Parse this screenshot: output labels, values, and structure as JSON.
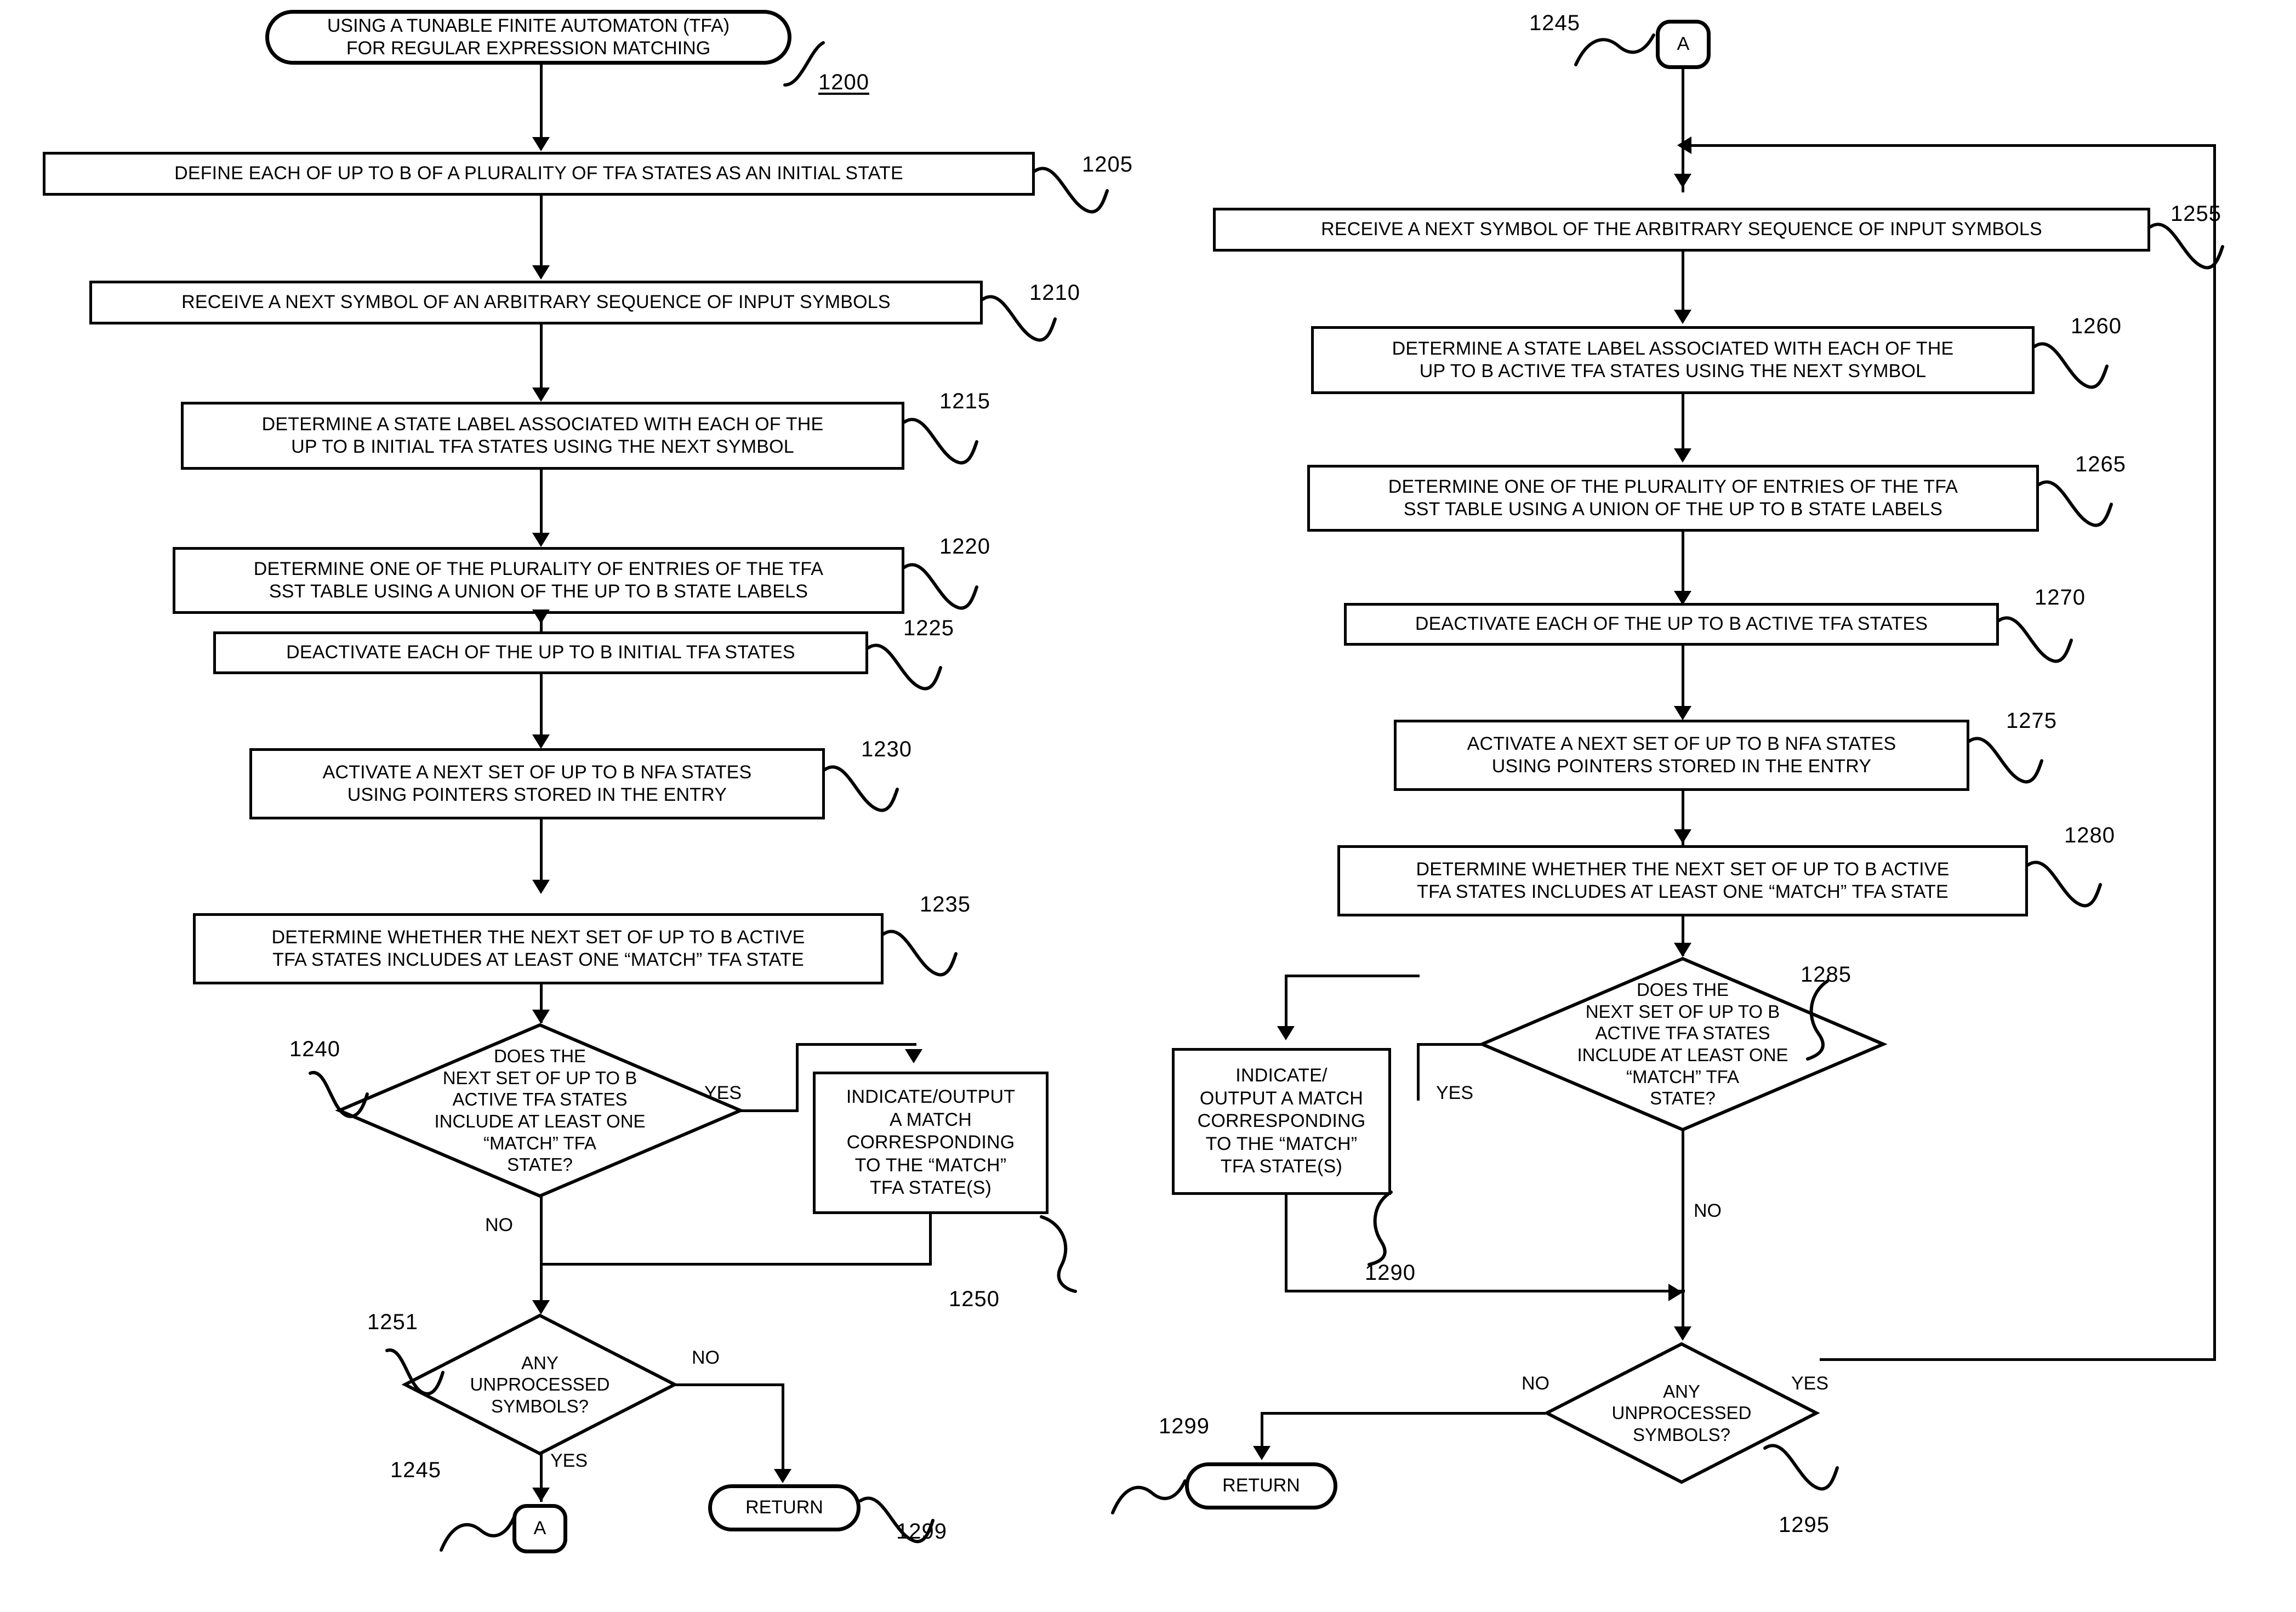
{
  "figure": {
    "title_node": {
      "label": "USING A TUNABLE FINITE AUTOMATON (TFA)\nFOR REGULAR EXPRESSION MATCHING",
      "line1": "USING A TUNABLE FINITE AUTOMATON (TFA)",
      "line2": "FOR REGULAR EXPRESSION MATCHING",
      "ref": "1200"
    }
  },
  "left_column": {
    "step_1205": {
      "text": "DEFINE EACH OF UP TO B OF A PLURALITY OF TFA STATES AS AN INITIAL STATE",
      "ref": "1205"
    },
    "step_1210": {
      "text": "RECEIVE A NEXT SYMBOL OF AN ARBITRARY SEQUENCE OF INPUT SYMBOLS",
      "ref": "1210"
    },
    "step_1215": {
      "line1": "DETERMINE A STATE LABEL ASSOCIATED WITH EACH OF THE",
      "line2": "UP TO B INITIAL TFA STATES USING THE NEXT SYMBOL",
      "ref": "1215"
    },
    "step_1220": {
      "line1": "DETERMINE ONE OF THE PLURALITY OF ENTRIES OF THE TFA",
      "line2": "SST TABLE USING A UNION OF THE UP TO B STATE LABELS",
      "ref": "1220"
    },
    "step_1225": {
      "text": "DEACTIVATE EACH OF THE UP TO B INITIAL TFA STATES",
      "ref": "1225"
    },
    "step_1230": {
      "line1": "ACTIVATE A NEXT SET OF UP TO B NFA STATES",
      "line2": "USING POINTERS STORED IN THE ENTRY",
      "ref": "1230"
    },
    "step_1235": {
      "line1": "DETERMINE WHETHER THE NEXT SET OF UP TO B ACTIVE",
      "line2": "TFA STATES INCLUDES AT LEAST ONE “MATCH” TFA STATE",
      "ref": "1235"
    },
    "decision_1240": {
      "line1": "DOES THE",
      "line2": "NEXT SET OF UP TO B",
      "line3": "ACTIVE TFA STATES",
      "line4": "INCLUDE AT LEAST ONE",
      "line5": "“MATCH” TFA",
      "line6": "STATE?",
      "ref": "1240",
      "yes_label": "YES",
      "no_label": "NO"
    },
    "step_1250": {
      "line1": "INDICATE/OUTPUT",
      "line2": "A MATCH",
      "line3": "CORRESPONDING",
      "line4": "TO THE “MATCH”",
      "line5": "TFA STATE(S)",
      "ref": "1250"
    },
    "decision_1251": {
      "line1": "ANY",
      "line2": "UNPROCESSED",
      "line3": "SYMBOLS?",
      "ref": "1251",
      "yes_label": "YES",
      "no_label": "NO"
    },
    "connector_1245": {
      "label": "A",
      "ref": "1245"
    },
    "return_1299": {
      "label": "RETURN",
      "ref": "1299"
    }
  },
  "right_column": {
    "connector_1245": {
      "label": "A",
      "ref": "1245"
    },
    "step_1255": {
      "text": "RECEIVE A NEXT SYMBOL OF THE ARBITRARY SEQUENCE OF INPUT SYMBOLS",
      "ref": "1255"
    },
    "step_1260": {
      "line1": "DETERMINE A STATE LABEL ASSOCIATED WITH EACH OF THE",
      "line2": "UP TO B ACTIVE TFA STATES USING THE NEXT SYMBOL",
      "ref": "1260"
    },
    "step_1265": {
      "line1": "DETERMINE ONE OF THE PLURALITY OF ENTRIES OF THE TFA",
      "line2": "SST TABLE USING A UNION OF THE UP TO B STATE LABELS",
      "ref": "1265"
    },
    "step_1270": {
      "text": "DEACTIVATE EACH OF THE UP TO B ACTIVE TFA STATES",
      "ref": "1270"
    },
    "step_1275": {
      "line1": "ACTIVATE A NEXT SET OF UP TO B NFA STATES",
      "line2": "USING POINTERS STORED IN THE ENTRY",
      "ref": "1275"
    },
    "step_1280": {
      "line1": "DETERMINE WHETHER THE NEXT SET OF UP TO B ACTIVE",
      "line2": "TFA STATES INCLUDES AT LEAST ONE “MATCH” TFA STATE",
      "ref": "1280"
    },
    "decision_1285": {
      "line1": "DOES THE",
      "line2": "NEXT SET OF UP TO B",
      "line3": "ACTIVE TFA STATES",
      "line4": "INCLUDE AT LEAST ONE",
      "line5": "“MATCH” TFA",
      "line6": "STATE?",
      "ref": "1285",
      "yes_label": "YES",
      "no_label": "NO"
    },
    "step_1290": {
      "line1": "INDICATE/",
      "line2": "OUTPUT A MATCH",
      "line3": "CORRESPONDING",
      "line4": "TO THE “MATCH”",
      "line5": "TFA STATE(S)",
      "ref": "1290"
    },
    "decision_1295": {
      "line1": "ANY",
      "line2": "UNPROCESSED",
      "line3": "SYMBOLS?",
      "ref": "1295",
      "yes_label": "YES",
      "no_label": "NO"
    },
    "return_1299": {
      "label": "RETURN",
      "ref": "1299"
    }
  }
}
